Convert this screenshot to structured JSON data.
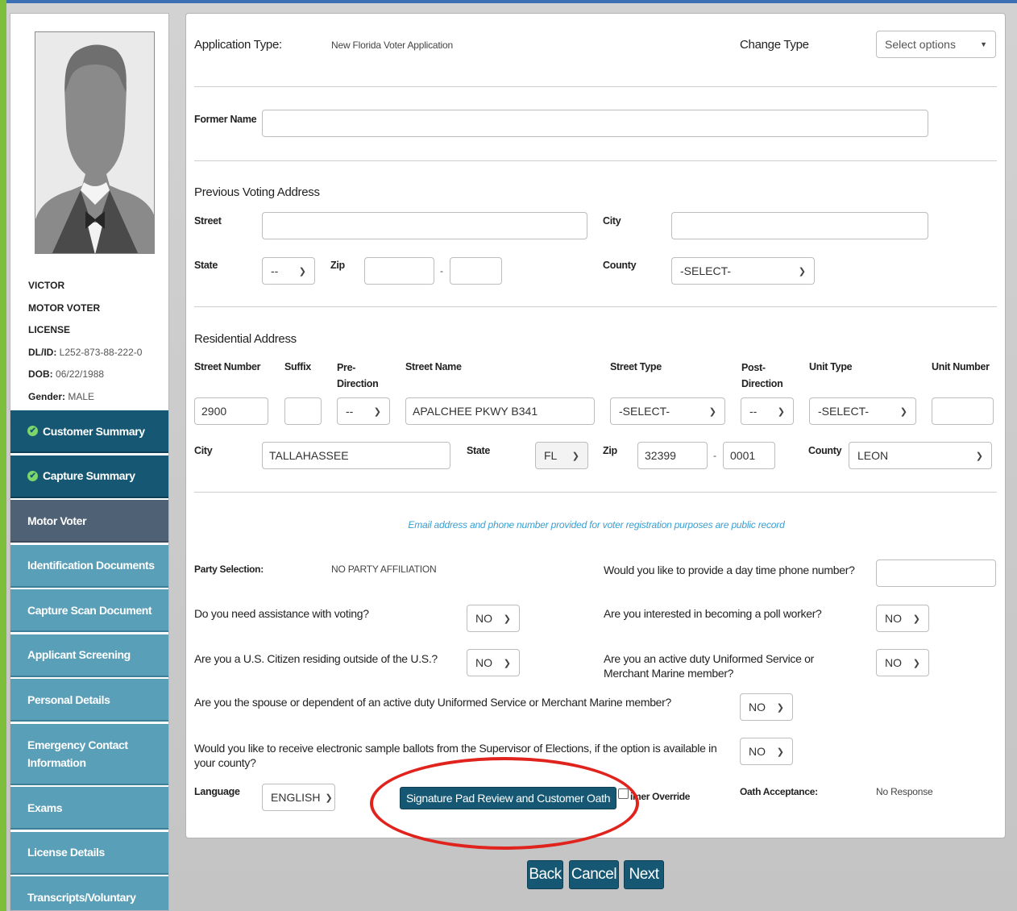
{
  "customer": {
    "first_name": "VICTOR",
    "line2": "MOTOR VOTER",
    "line3": "LICENSE",
    "dlid_label": "DL/ID:",
    "dlid": "L252-873-88-222-0",
    "dob_label": "DOB:",
    "dob": "06/22/1988",
    "gender_label": "Gender:",
    "gender": "MALE"
  },
  "sidebar": {
    "items": [
      {
        "label": "Customer Summary",
        "state": "complete"
      },
      {
        "label": "Capture Summary",
        "state": "complete"
      },
      {
        "label": "Motor Voter",
        "state": "active"
      },
      {
        "label": "Identification Documents",
        "state": "pending"
      },
      {
        "label": "Capture Scan Document",
        "state": "pending"
      },
      {
        "label": "Applicant Screening",
        "state": "pending"
      },
      {
        "label": "Personal Details",
        "state": "pending"
      },
      {
        "label": "Emergency Contact Information",
        "state": "pending"
      },
      {
        "label": "Exams",
        "state": "pending"
      },
      {
        "label": "License Details",
        "state": "pending"
      },
      {
        "label": "Transcripts/Voluntary",
        "state": "pending"
      }
    ]
  },
  "application": {
    "type_label": "Application Type:",
    "type_value": "New Florida Voter Application",
    "change_type_label": "Change Type",
    "change_type_placeholder": "Select options"
  },
  "former_name": {
    "label": "Former Name",
    "value": ""
  },
  "previous_address": {
    "heading": "Previous Voting Address",
    "street_label": "Street",
    "city_label": "City",
    "state_label": "State",
    "state_value": "--",
    "zip_label": "Zip",
    "zip_sep": "-",
    "county_label": "County",
    "county_value": "-SELECT-"
  },
  "residential": {
    "heading": "Residential Address",
    "col_street_number": "Street Number",
    "col_suffix": "Suffix",
    "col_pre_direction": "Pre-\nDirection",
    "col_street_name": "Street Name",
    "col_street_type": "Street Type",
    "col_post_direction": "Post-\nDirection",
    "col_unit_type": "Unit Type",
    "col_unit_number": "Unit Number",
    "street_number": "2900",
    "suffix": "",
    "pre_direction": "--",
    "street_name": "APALCHEE PKWY B341",
    "street_type": "-SELECT-",
    "post_direction": "--",
    "unit_type": "-SELECT-",
    "unit_number": "",
    "city_label": "City",
    "city": "TALLAHASSEE",
    "state_label": "State",
    "state": "FL",
    "zip_label": "Zip",
    "zip": "32399",
    "zip_sep": "-",
    "zip4": "0001",
    "county_label": "County",
    "county": "LEON"
  },
  "notice": "Email address and phone number provided for voter registration purposes are public record",
  "questions": {
    "party_label": "Party Selection:",
    "party_value": "NO PARTY AFFILIATION",
    "phone_q": "Would you like to provide a day time phone number?",
    "assist_q": "Do you need assistance with voting?",
    "assist_a": "NO",
    "poll_q": "Are you interested in becoming a poll worker?",
    "poll_a": "NO",
    "citizen_q": "Are you a U.S. Citizen residing outside of the U.S.?",
    "citizen_a": "NO",
    "duty_q": "Are you an active duty Uniformed Service or Merchant Marine member?",
    "duty_a": "NO",
    "spouse_q": "Are you the spouse or dependent of an active duty Uniformed Service or Merchant Marine member?",
    "spouse_a": "NO",
    "ballot_q": "Would you like to receive electronic sample ballots from the Supervisor of Elections, if the option is available in your county?",
    "ballot_a": "NO",
    "language_label": "Language",
    "language_value": "ENGLISH",
    "sig_button": "Signature Pad Review and Customer Oath",
    "timer_label": "imer Override",
    "oath_label": "Oath Acceptance:",
    "oath_value": "No Response"
  },
  "footer": {
    "back": "Back",
    "cancel": "Cancel",
    "next": "Next"
  },
  "colors": {
    "primary": "#165873",
    "nav": "#5a9fb8",
    "active_nav": "#4f6175",
    "accent_green": "#7dbf3c",
    "notice_text": "#3a9fd0",
    "highlight": "#e0231c"
  }
}
